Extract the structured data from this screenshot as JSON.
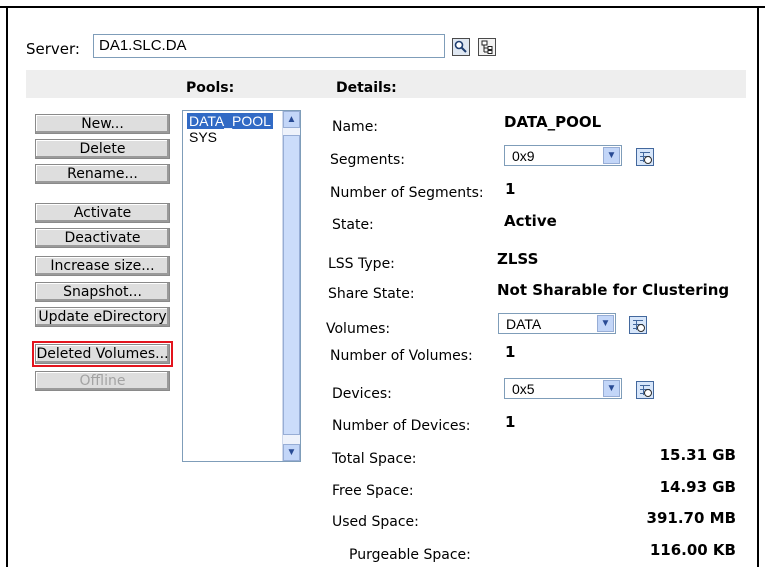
{
  "server": {
    "label": "Server:",
    "value": "DA1.SLC.DA"
  },
  "headers": {
    "pools": "Pools:",
    "details": "Details:"
  },
  "buttons": {
    "new": "New...",
    "delete": "Delete",
    "rename": "Rename...",
    "activate": "Activate",
    "deactivate": "Deactivate",
    "increase_size": "Increase size...",
    "snapshot": "Snapshot...",
    "update_edirectory": "Update eDirectory",
    "deleted_volumes": "Deleted Volumes...",
    "offline": "Offline"
  },
  "pools": [
    "DATA_POOL",
    "SYS"
  ],
  "details": {
    "name_label": "Name:",
    "name_value": "DATA_POOL",
    "segments_label": "Segments:",
    "segments_value": "0x9",
    "num_segments_label": "Number of Segments:",
    "num_segments_value": "1",
    "state_label": "State:",
    "state_value": "Active",
    "lss_label": "LSS Type:",
    "lss_value": "ZLSS",
    "share_label": "Share State:",
    "share_value": "Not Sharable for Clustering",
    "volumes_label": "Volumes:",
    "volumes_value": "DATA",
    "num_volumes_label": "Number of Volumes:",
    "num_volumes_value": "1",
    "devices_label": "Devices:",
    "devices_value": "0x5",
    "num_devices_label": "Number of Devices:",
    "num_devices_value": "1",
    "total_label": "Total Space:",
    "total_value": "15.31 GB",
    "free_label": "Free Space:",
    "free_value": "14.93 GB",
    "used_label": "Used Space:",
    "used_value": "391.70 MB",
    "purgeable_label": "Purgeable Space:",
    "purgeable_value": "116.00 KB"
  },
  "colors": {
    "selection": "#316ac5",
    "highlight_border": "#e3141d",
    "header_bg": "#eeeeee"
  }
}
